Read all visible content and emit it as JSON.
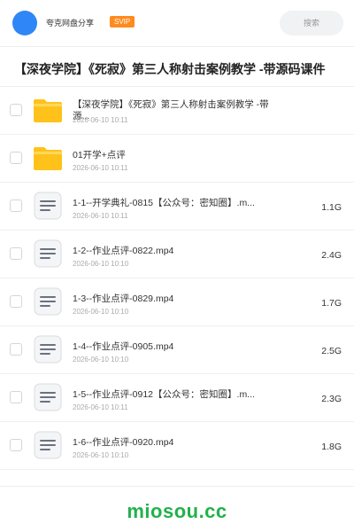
{
  "header": {
    "user_name": "夸克网盘分享",
    "vip_badge": "SVIP",
    "search_placeholder": "搜索",
    "avatar_color": "#2f86f6",
    "vip_color": "#ff8a1e"
  },
  "page_title": "【深夜学院】《死寂》第三人称射击案例教学 -带源码课件",
  "files": [
    {
      "name": "【深夜学院】《死寂》第三人称射击案例教学 -带源...",
      "date": "2026-06-10 10:11",
      "size": "",
      "type": "folder"
    },
    {
      "name": "01开学+点评",
      "date": "2026-06-10 10:11",
      "size": "",
      "type": "folder"
    },
    {
      "name": "1-1--开学典礼-0815【公众号：密知圈】.m...",
      "date": "2026-06-10 10:11",
      "size": "1.1G",
      "type": "file"
    },
    {
      "name": "1-2--作业点评-0822.mp4",
      "date": "2026-06-10 10:10",
      "size": "2.4G",
      "type": "file"
    },
    {
      "name": "1-3--作业点评-0829.mp4",
      "date": "2026-06-10 10:10",
      "size": "1.7G",
      "type": "file"
    },
    {
      "name": "1-4--作业点评-0905.mp4",
      "date": "2026-06-10 10:10",
      "size": "2.5G",
      "type": "file"
    },
    {
      "name": "1-5--作业点评-0912【公众号：密知圈】.m...",
      "date": "2026-06-10 10:11",
      "size": "2.3G",
      "type": "file"
    },
    {
      "name": "1-6--作业点评-0920.mp4",
      "date": "2026-06-10 10:10",
      "size": "1.8G",
      "type": "file"
    }
  ],
  "icons": {
    "folder": "folder-icon",
    "file": "document-icon"
  },
  "colors": {
    "folder": "#ffc21a",
    "watermark": "#22b14c"
  },
  "watermark": "miosou.cc"
}
